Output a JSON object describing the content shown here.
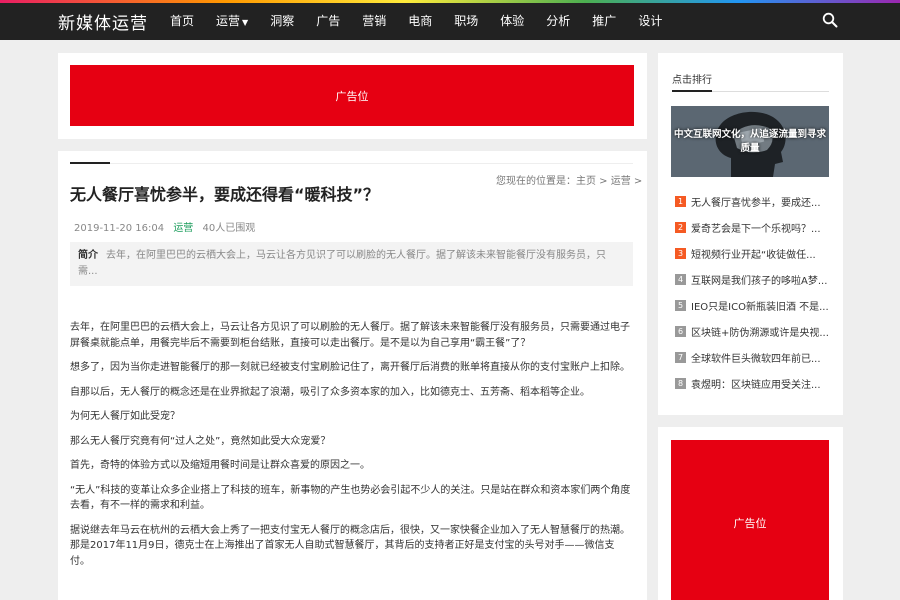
{
  "header": {
    "logo": "新媒体运营",
    "nav": [
      {
        "label": "首页",
        "dropdown": false
      },
      {
        "label": "运营",
        "dropdown": true
      },
      {
        "label": "洞察",
        "dropdown": false
      },
      {
        "label": "广告",
        "dropdown": false
      },
      {
        "label": "营销",
        "dropdown": false
      },
      {
        "label": "电商",
        "dropdown": false
      },
      {
        "label": "职场",
        "dropdown": false
      },
      {
        "label": "体验",
        "dropdown": false
      },
      {
        "label": "分析",
        "dropdown": false
      },
      {
        "label": "推广",
        "dropdown": false
      },
      {
        "label": "设计",
        "dropdown": false
      }
    ],
    "search_icon": "search-icon"
  },
  "top_ad": {
    "label": "广告位"
  },
  "article": {
    "breadcrumb": "您现在的位置是：主页 > 运营 >",
    "title": "无人餐厅喜忧参半，要成还得看“暖科技”？",
    "date": "2019-11-20 16:04",
    "category": "运营",
    "views": "40人已围观",
    "summary_label": "简介",
    "summary_text": "去年，在阿里巴巴的云栖大会上，马云让各方见识了可以刷脸的无人餐厅。据了解该未来智能餐厅没有服务员，只需...",
    "paragraphs": [
      "去年，在阿里巴巴的云栖大会上，马云让各方见识了可以刷脸的无人餐厅。据了解该未来智能餐厅没有服务员，只需要通过电子屏餐桌就能点单，用餐完毕后不需要到柜台结账，直接可以走出餐厅。是不是以为自己享用“霸王餐”了？",
      "想多了，因为当你走进智能餐厅的那一刻就已经被支付宝刷脸记住了，离开餐厅后消费的账单将直接从你的支付宝账户上扣除。",
      "自那以后，无人餐厅的概念还是在业界掀起了浪潮，吸引了众多资本家的加入，比如德克士、五芳斋、稻本稻等企业。",
      "为何无人餐厅如此受宠？",
      "那么无人餐厅究竟有何“过人之处”，竟然如此受大众宠爱？",
      "首先，奇特的体验方式以及缩短用餐时间是让群众喜爱的原因之一。",
      "“无人”科技的变革让众多企业搭上了科技的班车，新事物的产生也势必会引起不少人的关注。只是站在群众和资本家们两个角度去看，有不一样的需求和利益。",
      "据说继去年马云在杭州的云栖大会上秀了一把支付宝无人餐厅的概念店后，很快，又一家快餐企业加入了无人智慧餐厅的热潮。那是2017年11月9日，德克士在上海推出了首家无人自助式智慧餐厅，其背后的支持者正好是支付宝的头号对手——微信支付。"
    ]
  },
  "sidebar": {
    "title": "点击排行",
    "hero_caption": "中文互联网文化，从追逐流量到寻求质量",
    "ranks": [
      {
        "num": "1",
        "text": "无人餐厅喜忧参半，要成还..."
      },
      {
        "num": "2",
        "text": "爱奇艺会是下一个乐视吗？..."
      },
      {
        "num": "3",
        "text": "短视频行业开起“收徒做任..."
      },
      {
        "num": "4",
        "text": "互联网是我们孩子的哆啦A梦..."
      },
      {
        "num": "5",
        "text": "IEO只是ICO新瓶装旧酒 不是..."
      },
      {
        "num": "6",
        "text": "区块链+防伪溯源或许是央视..."
      },
      {
        "num": "7",
        "text": "全球软件巨头微软四年前已..."
      },
      {
        "num": "8",
        "text": "袁煜明：区块链应用受关注..."
      }
    ],
    "ad_label": "广告位"
  },
  "colors": {
    "ad_red": "#e60012",
    "top_bar": "#222222",
    "rank_hot": "#f55a23",
    "category_green": "#1a9c5b"
  }
}
